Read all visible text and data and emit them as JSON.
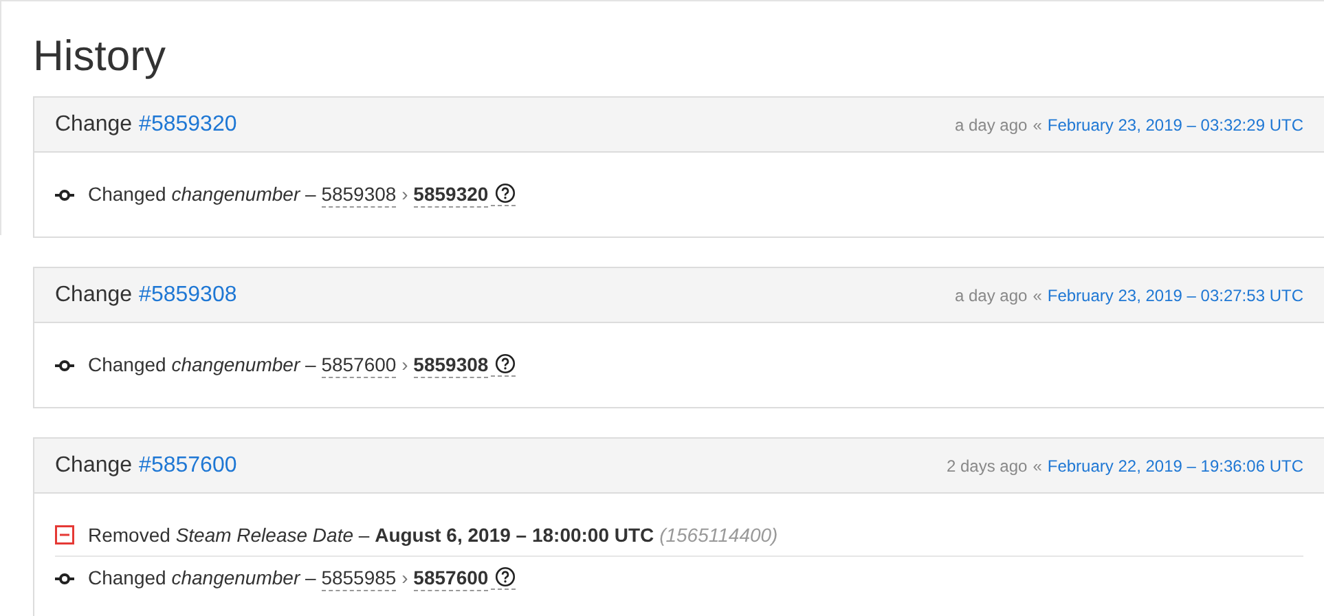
{
  "title": "History",
  "changes": [
    {
      "label": "Change",
      "number": "#5859320",
      "ago": "a day ago",
      "separator": "«",
      "date": "February 23, 2019 – 03:32:29 UTC",
      "rows": [
        {
          "kind": "changed",
          "action": "Changed",
          "key": "changenumber",
          "dash": "–",
          "old": "5859308",
          "arrow": "›",
          "new": "5859320"
        }
      ]
    },
    {
      "label": "Change",
      "number": "#5859308",
      "ago": "a day ago",
      "separator": "«",
      "date": "February 23, 2019 – 03:27:53 UTC",
      "rows": [
        {
          "kind": "changed",
          "action": "Changed",
          "key": "changenumber",
          "dash": "–",
          "old": "5857600",
          "arrow": "›",
          "new": "5859308"
        }
      ]
    },
    {
      "label": "Change",
      "number": "#5857600",
      "ago": "2 days ago",
      "separator": "«",
      "date": "February 22, 2019 – 19:36:06 UTC",
      "rows": [
        {
          "kind": "removed",
          "action": "Removed",
          "key": "Steam Release Date",
          "dash": "–",
          "value": "August 6, 2019 – 18:00:00 UTC",
          "raw": "(1565114400)"
        },
        {
          "kind": "changed",
          "action": "Changed",
          "key": "changenumber",
          "dash": "–",
          "old": "5855985",
          "arrow": "›",
          "new": "5857600"
        }
      ]
    }
  ]
}
